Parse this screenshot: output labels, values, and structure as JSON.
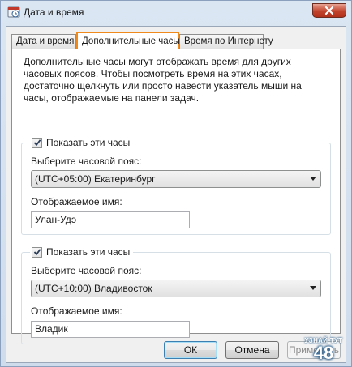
{
  "window": {
    "title": "Дата и время"
  },
  "tabs": [
    {
      "label": "Дата и время"
    },
    {
      "label": "Дополнительные часы"
    },
    {
      "label": "Время по Интернету"
    }
  ],
  "description": "Дополнительные часы могут отображать время для других часовых поясов. Чтобы посмотреть время на этих часах, достаточно щелкнуть или просто навести указатель мыши на часы, отображаемые на панели задач.",
  "clock1": {
    "show_label": "Показать эти часы",
    "checked": true,
    "timezone_label": "Выберите часовой пояс:",
    "timezone_value": "(UTC+05:00) Екатеринбург",
    "name_label": "Отображаемое имя:",
    "name_value": "Улан-Удэ"
  },
  "clock2": {
    "show_label": "Показать эти часы",
    "checked": true,
    "timezone_label": "Выберите часовой пояс:",
    "timezone_value": "(UTC+10:00) Владивосток",
    "name_label": "Отображаемое имя:",
    "name_value": "Владик"
  },
  "buttons": {
    "ok": "ОК",
    "cancel": "Отмена",
    "apply": "Применить"
  },
  "watermark": {
    "small": "УЗНАЙ ТУТ",
    "big": "48"
  },
  "colors": {
    "active_tab_border": "#f08a1c",
    "close_button": "#c2432c"
  }
}
